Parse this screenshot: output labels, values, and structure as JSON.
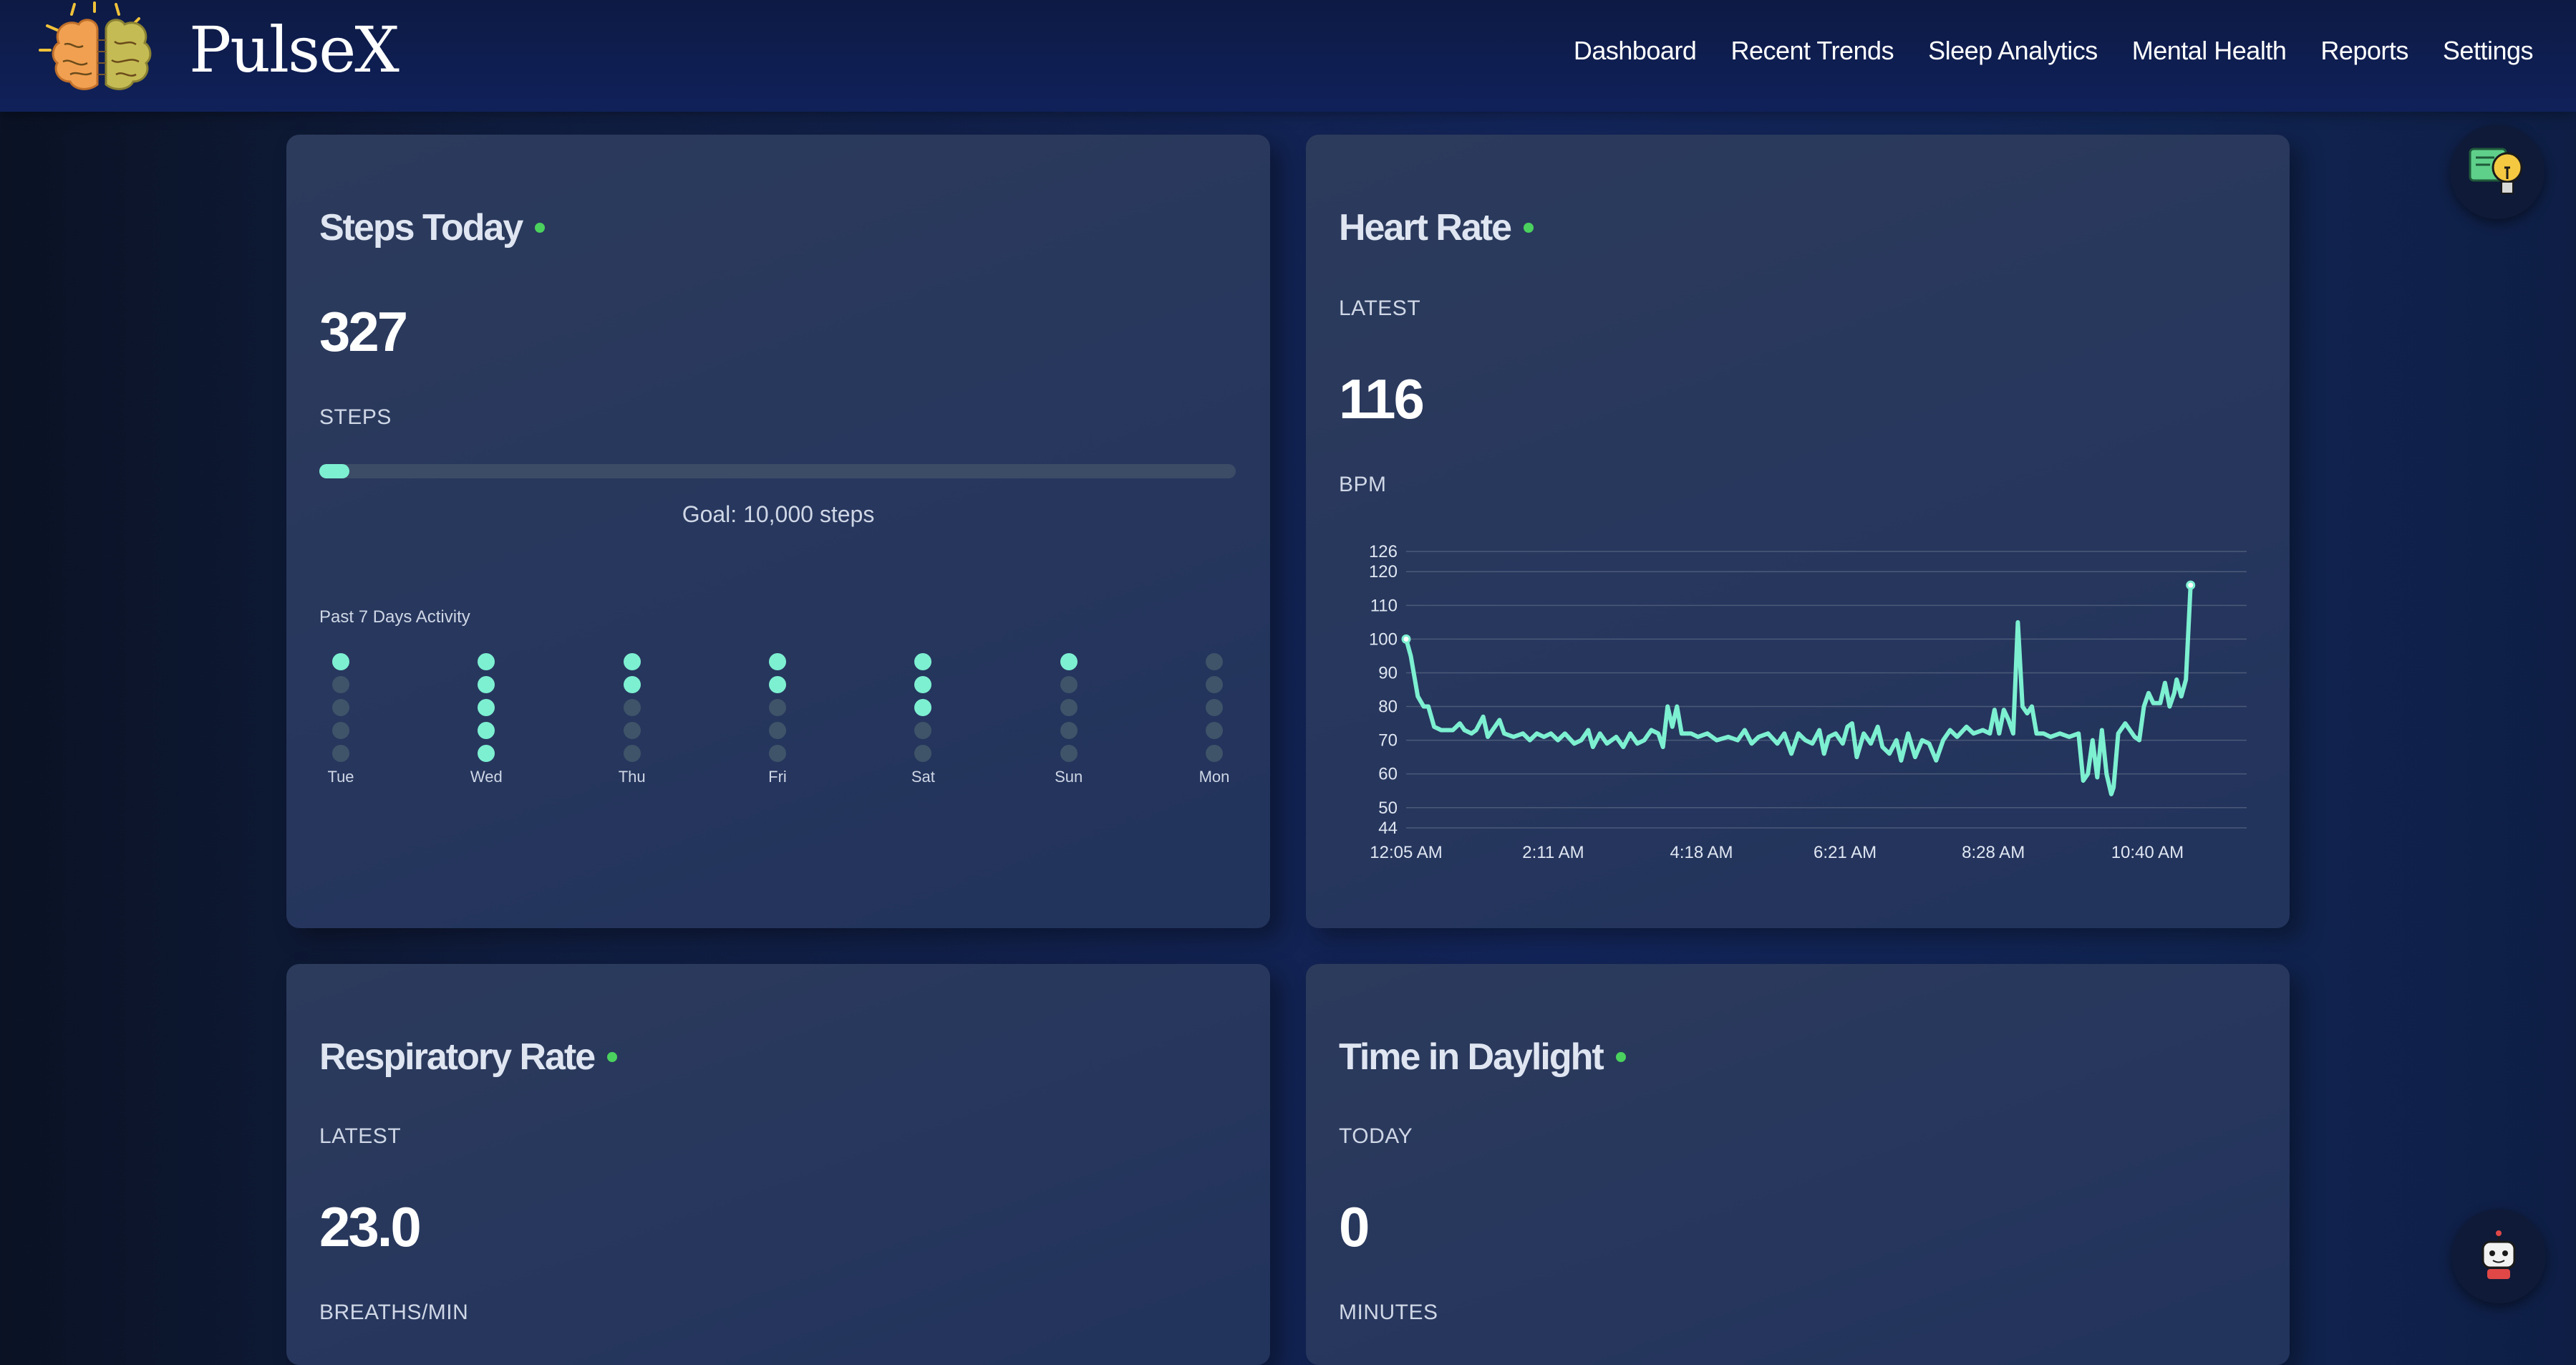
{
  "app": {
    "name": "PulseX"
  },
  "nav": [
    "Dashboard",
    "Recent Trends",
    "Sleep Analytics",
    "Mental Health",
    "Reports",
    "Settings"
  ],
  "steps_card": {
    "title": "Steps Today",
    "value": "327",
    "unit": "STEPS",
    "goal_text": "Goal: 10,000 steps",
    "progress_fraction": 0.0327,
    "past_label": "Past 7 Days Activity",
    "days": [
      {
        "name": "Tue",
        "level": 1
      },
      {
        "name": "Wed",
        "level": 5
      },
      {
        "name": "Thu",
        "level": 2
      },
      {
        "name": "Fri",
        "level": 2
      },
      {
        "name": "Sat",
        "level": 3
      },
      {
        "name": "Sun",
        "level": 1
      },
      {
        "name": "Mon",
        "level": 0
      }
    ]
  },
  "heart_card": {
    "title": "Heart Rate",
    "sublabel": "LATEST",
    "value": "116",
    "unit": "BPM"
  },
  "resp_card": {
    "title": "Respiratory Rate",
    "sublabel": "LATEST",
    "value": "23.0",
    "unit": "BREATHS/MIN"
  },
  "daylight_card": {
    "title": "Time in Daylight",
    "sublabel": "TODAY",
    "value": "0",
    "unit": "MINUTES"
  },
  "colors": {
    "accent": "#7ef0d2",
    "live": "#4bd15e"
  },
  "icons": {
    "help": "lightbulb-help-icon",
    "assistant": "robot-assistant-icon"
  },
  "chart_data": {
    "type": "line",
    "ylim": [
      44,
      126
    ],
    "y_ticks": [
      44,
      50,
      60,
      70,
      80,
      90,
      100,
      110,
      120,
      126
    ],
    "x_tick_labels": [
      "12:05 AM",
      "2:11 AM",
      "4:18 AM",
      "6:21 AM",
      "8:28 AM",
      "10:40 AM"
    ],
    "x_range": [
      0,
      720
    ],
    "x_ticks": [
      0,
      126,
      253,
      376,
      503,
      635
    ],
    "series": [
      {
        "values": [
          [
            0,
            100
          ],
          [
            4,
            95
          ],
          [
            10,
            83
          ],
          [
            15,
            80
          ],
          [
            19,
            80
          ],
          [
            24,
            74
          ],
          [
            30,
            73
          ],
          [
            40,
            73
          ],
          [
            46,
            75
          ],
          [
            50,
            73
          ],
          [
            56,
            72
          ],
          [
            60,
            73
          ],
          [
            66,
            77
          ],
          [
            70,
            71
          ],
          [
            76,
            74
          ],
          [
            80,
            76
          ],
          [
            84,
            72
          ],
          [
            92,
            71
          ],
          [
            100,
            72
          ],
          [
            106,
            70
          ],
          [
            112,
            72
          ],
          [
            118,
            71
          ],
          [
            124,
            72
          ],
          [
            130,
            70
          ],
          [
            136,
            72
          ],
          [
            144,
            69
          ],
          [
            150,
            70
          ],
          [
            156,
            73
          ],
          [
            160,
            68
          ],
          [
            166,
            72
          ],
          [
            172,
            69
          ],
          [
            180,
            71
          ],
          [
            186,
            68
          ],
          [
            192,
            72
          ],
          [
            198,
            69
          ],
          [
            204,
            70
          ],
          [
            210,
            73
          ],
          [
            216,
            72
          ],
          [
            220,
            68
          ],
          [
            224,
            80
          ],
          [
            228,
            74
          ],
          [
            232,
            80
          ],
          [
            236,
            72
          ],
          [
            244,
            72
          ],
          [
            250,
            71
          ],
          [
            258,
            72
          ],
          [
            266,
            70
          ],
          [
            276,
            71
          ],
          [
            284,
            70
          ],
          [
            290,
            73
          ],
          [
            296,
            69
          ],
          [
            302,
            71
          ],
          [
            310,
            72
          ],
          [
            318,
            69
          ],
          [
            324,
            72
          ],
          [
            330,
            66
          ],
          [
            336,
            72
          ],
          [
            342,
            70
          ],
          [
            348,
            69
          ],
          [
            354,
            73
          ],
          [
            358,
            66
          ],
          [
            362,
            71
          ],
          [
            368,
            72
          ],
          [
            374,
            69
          ],
          [
            378,
            74
          ],
          [
            382,
            75
          ],
          [
            386,
            65
          ],
          [
            392,
            72
          ],
          [
            398,
            69
          ],
          [
            404,
            74
          ],
          [
            408,
            68
          ],
          [
            414,
            66
          ],
          [
            420,
            70
          ],
          [
            424,
            64
          ],
          [
            430,
            72
          ],
          [
            436,
            65
          ],
          [
            442,
            70
          ],
          [
            448,
            69
          ],
          [
            454,
            64
          ],
          [
            460,
            70
          ],
          [
            466,
            73
          ],
          [
            472,
            71
          ],
          [
            480,
            74
          ],
          [
            486,
            72
          ],
          [
            494,
            73
          ],
          [
            500,
            72
          ],
          [
            504,
            79
          ],
          [
            508,
            72
          ],
          [
            512,
            79
          ],
          [
            516,
            76
          ],
          [
            520,
            72
          ],
          [
            524,
            105
          ],
          [
            528,
            80
          ],
          [
            532,
            78
          ],
          [
            536,
            80
          ],
          [
            540,
            72
          ],
          [
            546,
            72
          ],
          [
            552,
            71
          ],
          [
            560,
            72
          ],
          [
            568,
            71
          ],
          [
            576,
            72
          ],
          [
            580,
            58
          ],
          [
            584,
            60
          ],
          [
            588,
            70
          ],
          [
            592,
            59
          ],
          [
            596,
            73
          ],
          [
            600,
            60
          ],
          [
            604,
            54
          ],
          [
            606,
            56
          ],
          [
            610,
            72
          ],
          [
            616,
            75
          ],
          [
            624,
            71
          ],
          [
            628,
            70
          ],
          [
            632,
            80
          ],
          [
            636,
            84
          ],
          [
            640,
            81
          ],
          [
            646,
            81
          ],
          [
            650,
            87
          ],
          [
            654,
            80
          ],
          [
            658,
            84
          ],
          [
            660,
            88
          ],
          [
            664,
            83
          ],
          [
            668,
            88
          ],
          [
            672,
            116
          ]
        ]
      }
    ]
  }
}
